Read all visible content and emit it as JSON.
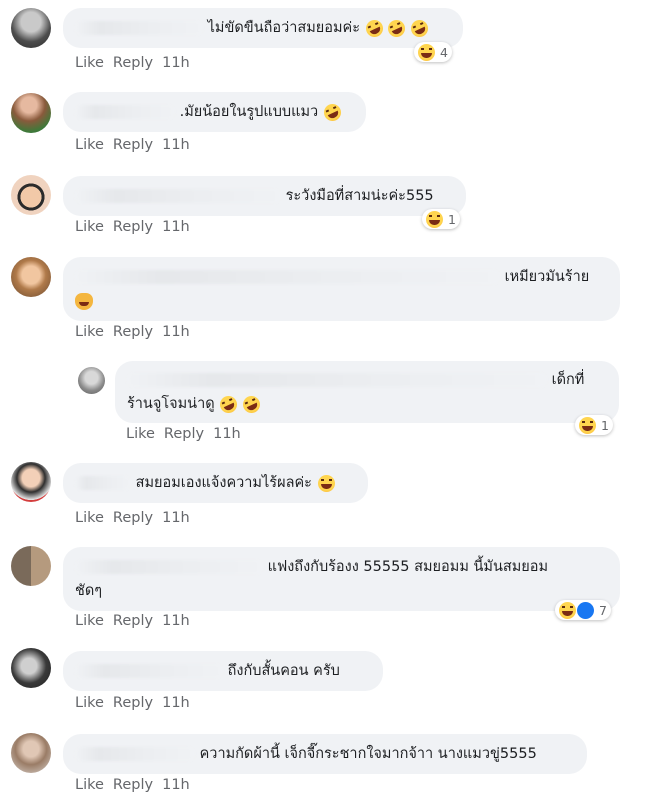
{
  "actions": {
    "like": "Like",
    "reply": "Reply",
    "time": "11h"
  },
  "comments": [
    {
      "text": "ไม่ขัดขืนถือว่าสมยอมค่ะ",
      "reaction_count": "4"
    },
    {
      "text": ".มัยน้อยในรูปแบบแมว",
      "reaction_count": ""
    },
    {
      "text": "ระวังมือที่สามน่ะค่ะ555",
      "reaction_count": "1"
    },
    {
      "text": "เหมียวมันร้าย",
      "reaction_count": ""
    },
    {
      "text_line1": "เด็กที่",
      "text_line2": "ร้านจูโจมน่าดู",
      "reaction_count": "1"
    },
    {
      "text": "สมยอมเองแจ้งความไร้ผลค่ะ",
      "reaction_count": ""
    },
    {
      "text_line1": "แฟงถึงกับร้องง 55555 สมยอมม นี้มันสมยอม",
      "text_line2": "ชัดๆ",
      "reaction_count": "7"
    },
    {
      "text": "ถึงกับสั้นคอน ครับ",
      "reaction_count": ""
    },
    {
      "text": "ความกัดผ้านี้ เจ็กจี๊กระชากใจมากจ้าา นางแมวขู่5555",
      "reaction_count": ""
    }
  ],
  "colors": {
    "bubble": "#f0f2f5",
    "meta": "#65676b",
    "like_blue": "#1877f2"
  }
}
